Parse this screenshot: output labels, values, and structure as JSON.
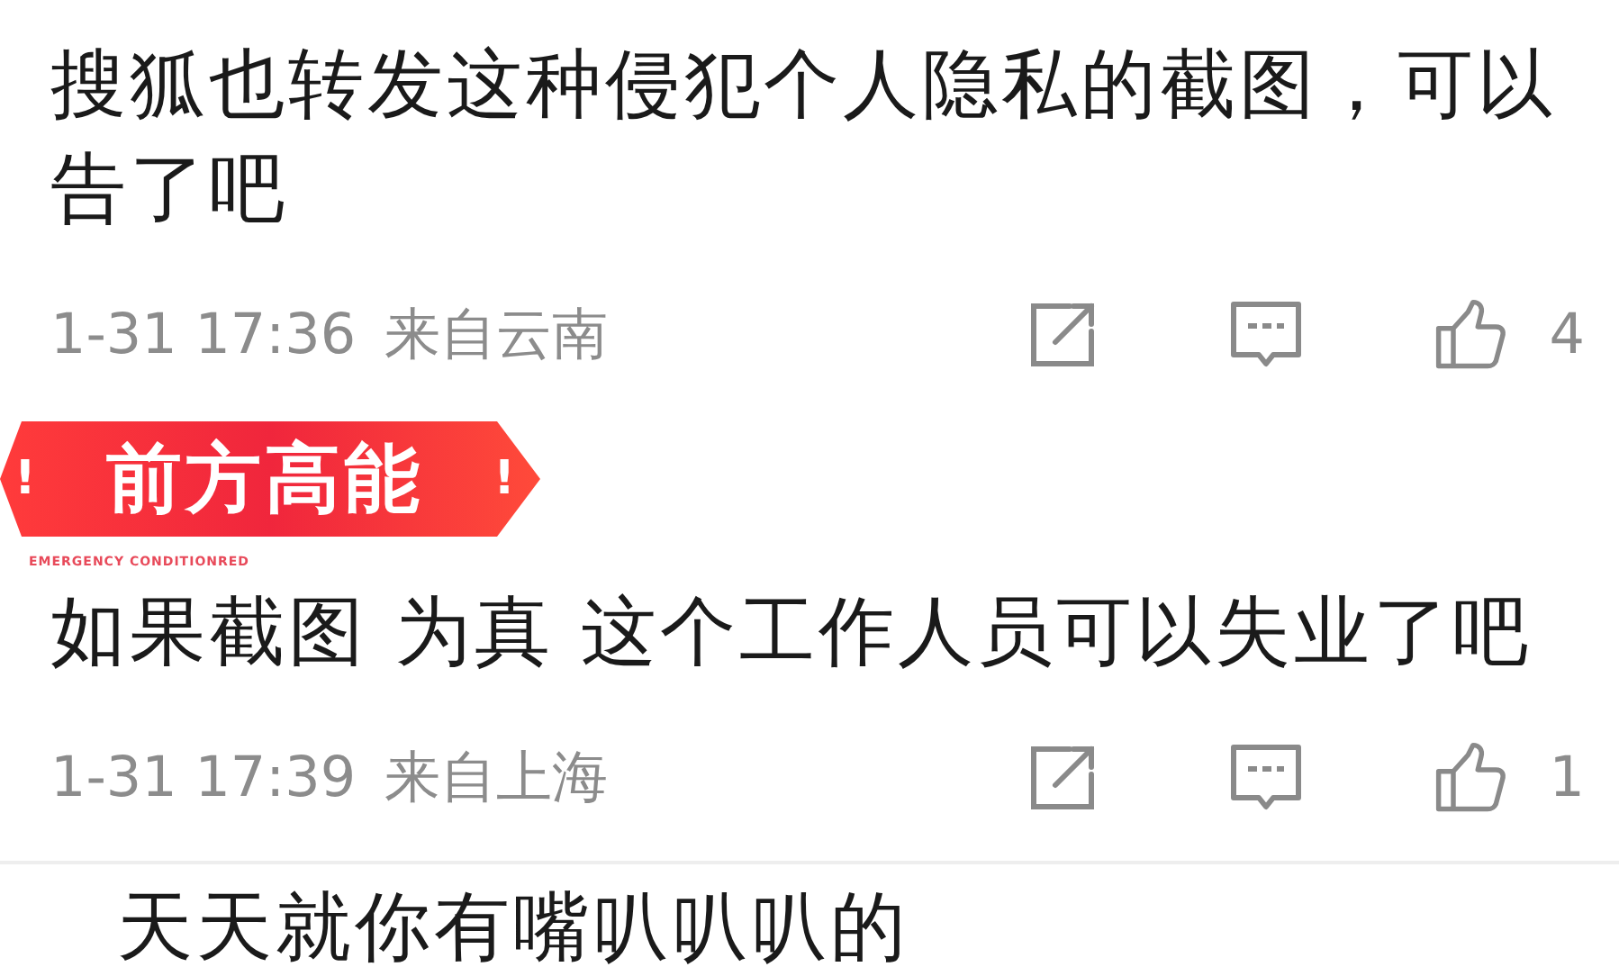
{
  "feed": [
    {
      "kind": "comment",
      "text": "搜狐也转发这种侵犯个人隐私的截图，可以告了吧",
      "time": "1-31 17:36",
      "location": "来自云南",
      "likes": "4"
    },
    {
      "kind": "banner",
      "title": "前方高能",
      "mark": "!",
      "subtitle": "EMERGENCY CONDITIONRED"
    },
    {
      "kind": "comment",
      "text": "如果截图 为真 这个工作人员可以失业了吧",
      "time": "1-31 17:39",
      "location": "来自上海",
      "likes": "1"
    },
    {
      "kind": "reply",
      "text": "天天就你有嘴叭叭叭的"
    }
  ]
}
